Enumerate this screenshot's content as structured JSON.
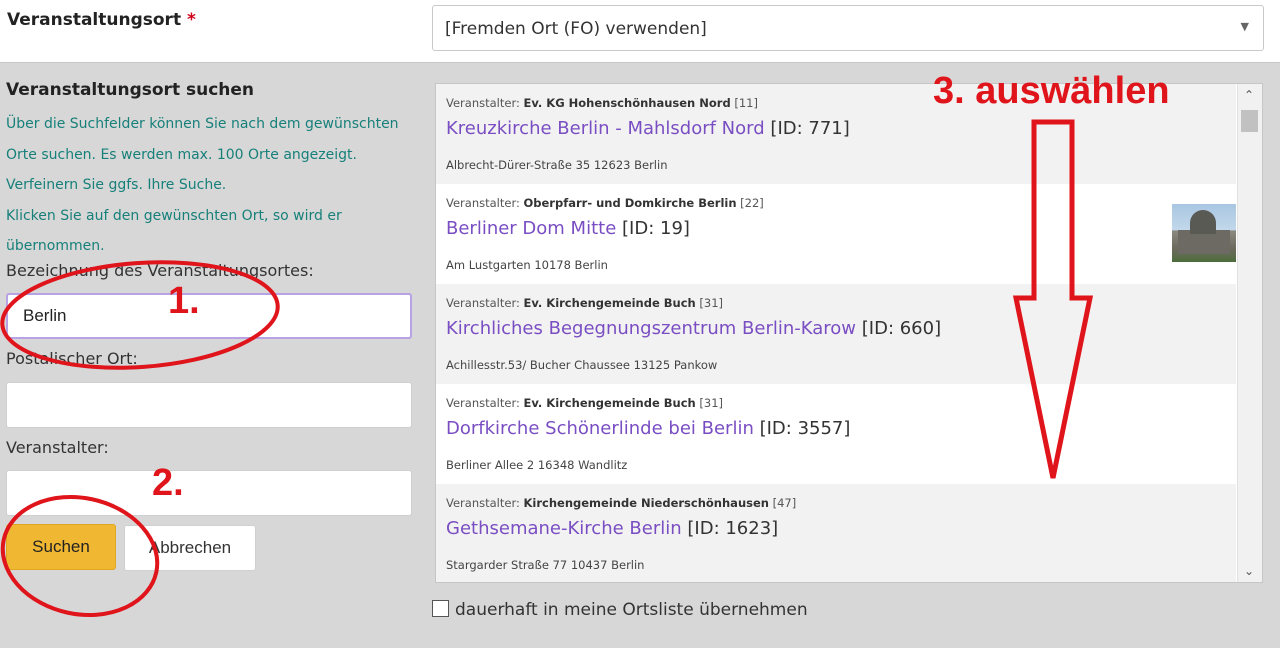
{
  "venue_field": {
    "label": "Veranstaltungsort",
    "required_mark": "*",
    "selected": "[Fremden Ort (FO) verwenden]"
  },
  "search_panel": {
    "title": "Veranstaltungsort suchen",
    "help_lines": [
      "Über die Suchfelder können Sie nach dem gewünschten",
      "Orte suchen. Es werden max. 100 Orte angezeigt.",
      "Verfeinern Sie ggfs. Ihre Suche.",
      "Klicken Sie auf den gewünschten Ort, so wird er",
      "übernommen."
    ],
    "name_label": "Bezeichnung des Veranstaltungsortes:",
    "name_value": "Berlin",
    "city_label": "Postalischer Ort:",
    "city_value": "",
    "organizer_label": "Veranstalter:",
    "organizer_value": "",
    "search_button": "Suchen",
    "cancel_button": "Abbrechen"
  },
  "results": [
    {
      "prefix": "Veranstalter:",
      "organizer": "Ev. KG Hohenschönhausen Nord",
      "org_id": "[11]",
      "name": "Kreuzkirche Berlin - Mahlsdorf Nord",
      "id_text": "[ID: 771]",
      "address": "Albrecht-Dürer-Straße 35 12623 Berlin"
    },
    {
      "prefix": "Veranstalter:",
      "organizer": "Oberpfarr- und Domkirche Berlin",
      "org_id": "[22]",
      "name": "Berliner Dom Mitte",
      "id_text": "[ID: 19]",
      "address": "Am Lustgarten 10178 Berlin",
      "has_thumbnail": true
    },
    {
      "prefix": "Veranstalter:",
      "organizer": "Ev. Kirchengemeinde Buch",
      "org_id": "[31]",
      "name": "Kirchliches Begegnungszentrum Berlin-Karow",
      "id_text": "[ID: 660]",
      "address": "Achillesstr.53/ Bucher Chaussee 13125 Pankow"
    },
    {
      "prefix": "Veranstalter:",
      "organizer": "Ev. Kirchengemeinde Buch",
      "org_id": "[31]",
      "name": "Dorfkirche Schönerlinde bei Berlin",
      "id_text": "[ID: 3557]",
      "address": "Berliner Allee 2 16348 Wandlitz"
    },
    {
      "prefix": "Veranstalter:",
      "organizer": "Kirchengemeinde Niederschönhausen",
      "org_id": "[47]",
      "name": "Gethsemane-Kirche Berlin",
      "id_text": "[ID: 1623]",
      "address": "Stargarder Straße 77 10437 Berlin"
    }
  ],
  "persist_checkbox": {
    "label": "dauerhaft in meine Ortsliste übernehmen",
    "checked": false
  },
  "annotations": {
    "step1": "1.",
    "step2": "2.",
    "step3": "3. auswählen",
    "color": "#e0141b"
  },
  "colors": {
    "panel_bg": "#d7d7d7",
    "help_text": "#17807a",
    "link": "#7a4ec3",
    "primary_button": "#f0b732"
  }
}
